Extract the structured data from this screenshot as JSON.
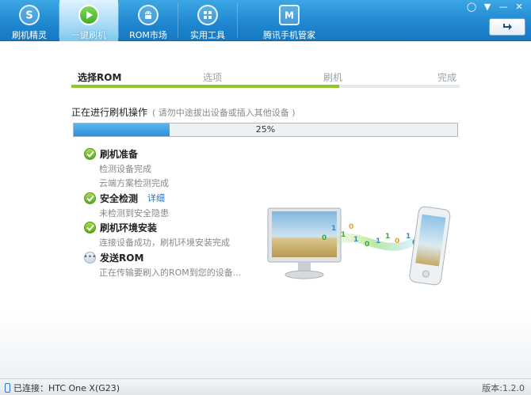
{
  "nav": {
    "items": [
      {
        "label": "刷机精灵",
        "icon": "s-logo-icon"
      },
      {
        "label": "一键刷机",
        "icon": "play-icon"
      },
      {
        "label": "ROM市场",
        "icon": "android-icon"
      },
      {
        "label": "实用工具",
        "icon": "grid-icon"
      },
      {
        "label": "腾讯手机管家",
        "icon": "shield-m-icon"
      }
    ],
    "active": "一键刷机"
  },
  "window_controls": [
    "feedback-icon",
    "menu-icon",
    "minimize-icon",
    "close-icon"
  ],
  "steps": {
    "items": [
      "选择ROM",
      "选项",
      "刷机",
      "完成"
    ],
    "current": "选择ROM",
    "progress_fraction": 0.69
  },
  "operation": {
    "title": "正在进行刷机操作",
    "hint": "( 请勿中途拔出设备或插入其他设备 )"
  },
  "progress": {
    "percent": 25,
    "label": "25%"
  },
  "tasks": [
    {
      "name": "刷机准备",
      "status": "done",
      "subs": [
        "检测设备完成",
        "云端方案检测完成"
      ]
    },
    {
      "name": "安全检测",
      "status": "done",
      "link": "详细",
      "subs": [
        "未检测到安全隐患"
      ]
    },
    {
      "name": "刷机环境安装",
      "status": "done",
      "subs": [
        "连接设备成功，刷机环境安装完成"
      ]
    },
    {
      "name": "发送ROM",
      "status": "pending",
      "subs": [
        "正在传输要刷入的ROM到您的设备..."
      ]
    }
  ],
  "statusbar": {
    "connection": "已连接：HTC One X(G23)",
    "version": "版本:1.2.0"
  },
  "colors": {
    "header": "#1e86cf",
    "accent_green": "#8fc82b",
    "progress_blue": "#2a8fd8",
    "link": "#2a74c9"
  }
}
